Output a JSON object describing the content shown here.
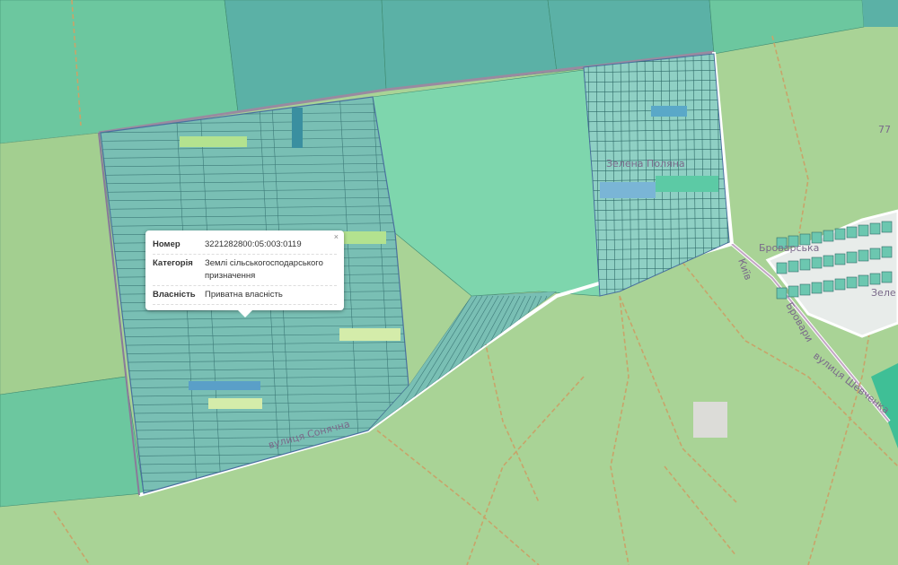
{
  "map": {
    "labels": {
      "village_1": "Зелена Поляна",
      "street_brovarska": "Броварська",
      "street_kyiv": "Київ",
      "street_brovary": "Бровари",
      "street_shevchenka": "вулиця Шевченка",
      "street_bottom": "вулиця Сонячна",
      "village_2": "Зеле",
      "number": "77"
    },
    "colors": {
      "forest": "#a9d396",
      "field": "#6cc79f",
      "field_teal": "#5bb1a6",
      "parcels": "#79bfb4",
      "meadow": "#7ed6ad",
      "road": "#ffffff",
      "path": "#c8a46a"
    }
  },
  "popup": {
    "close_label": "×",
    "rows": [
      {
        "key": "Номер",
        "value": "3221282800:05:003:0119"
      },
      {
        "key": "Категорія",
        "value": "Землі сільськогосподарського призначення"
      },
      {
        "key": "Власність",
        "value": "Приватна власність"
      }
    ]
  }
}
